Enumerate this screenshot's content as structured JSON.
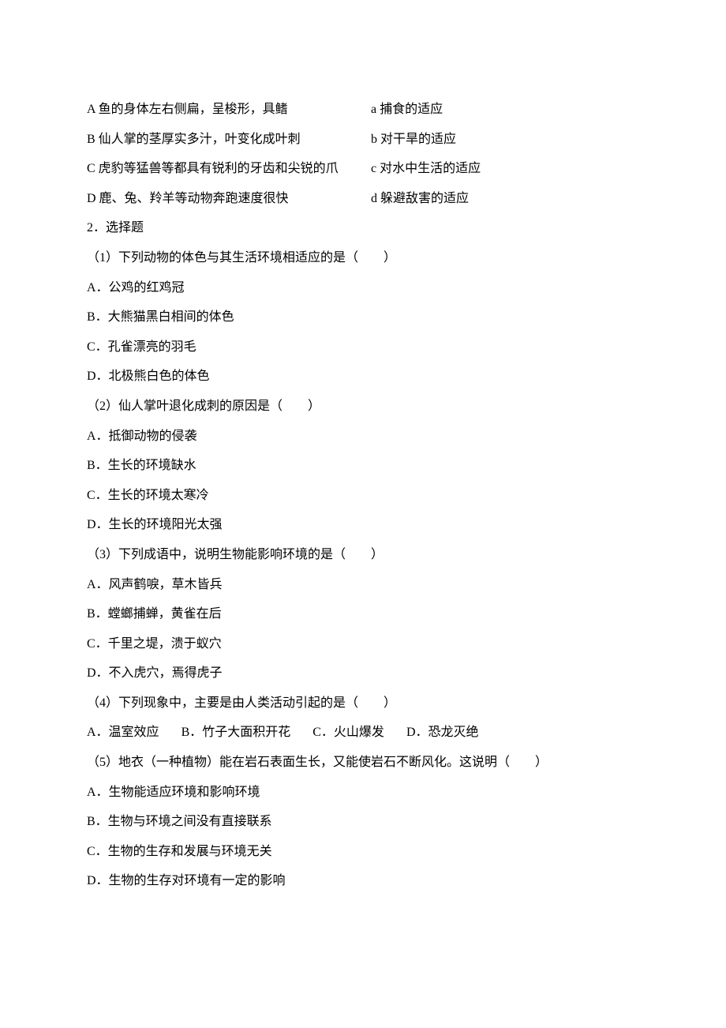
{
  "matching": {
    "left": [
      "A 鱼的身体左右侧扁，呈梭形，具鳍",
      "B 仙人掌的茎厚实多汁，叶变化成叶刺",
      "C 虎豹等猛兽等都具有锐利的牙齿和尖锐的爪",
      "D 鹿、兔、羚羊等动物奔跑速度很快"
    ],
    "right": [
      "a 捕食的适应",
      "b 对干旱的适应",
      "c 对水中生活的适应",
      "d 躲避敌害的适应"
    ]
  },
  "section2": {
    "title": "2．选择题",
    "q1": {
      "stem": "（1）下列动物的体色与其生活环境相适应的是（　　）",
      "options": [
        "A．公鸡的红鸡冠",
        "B．大熊猫黑白相间的体色",
        "C．孔雀漂亮的羽毛",
        "D．北极熊白色的体色"
      ]
    },
    "q2": {
      "stem": "（2）仙人掌叶退化成刺的原因是（　　）",
      "options": [
        "A．抵御动物的侵袭",
        "B．生长的环境缺水",
        "C．生长的环境太寒冷",
        "D．生长的环境阳光太强"
      ]
    },
    "q3": {
      "stem": "（3）下列成语中，说明生物能影响环境的是（　　）",
      "options": [
        "A．风声鹤唳，草木皆兵",
        "B．螳螂捕蝉，黄雀在后",
        "C．千里之堤，溃于蚁穴",
        "D．不入虎穴，焉得虎子"
      ]
    },
    "q4": {
      "stem": "（4）下列现象中，主要是由人类活动引起的是（　　）",
      "options": [
        "A．温室效应",
        "B．竹子大面积开花",
        "C．火山爆发",
        "D．恐龙灭绝"
      ]
    },
    "q5": {
      "stem": "（5）地衣（一种植物）能在岩石表面生长，又能使岩石不断风化。这说明（　　）",
      "options": [
        "A．生物能适应环境和影响环境",
        "B．生物与环境之间没有直接联系",
        "C．生物的生存和发展与环境无关",
        "D．生物的生存对环境有一定的影响"
      ]
    }
  }
}
